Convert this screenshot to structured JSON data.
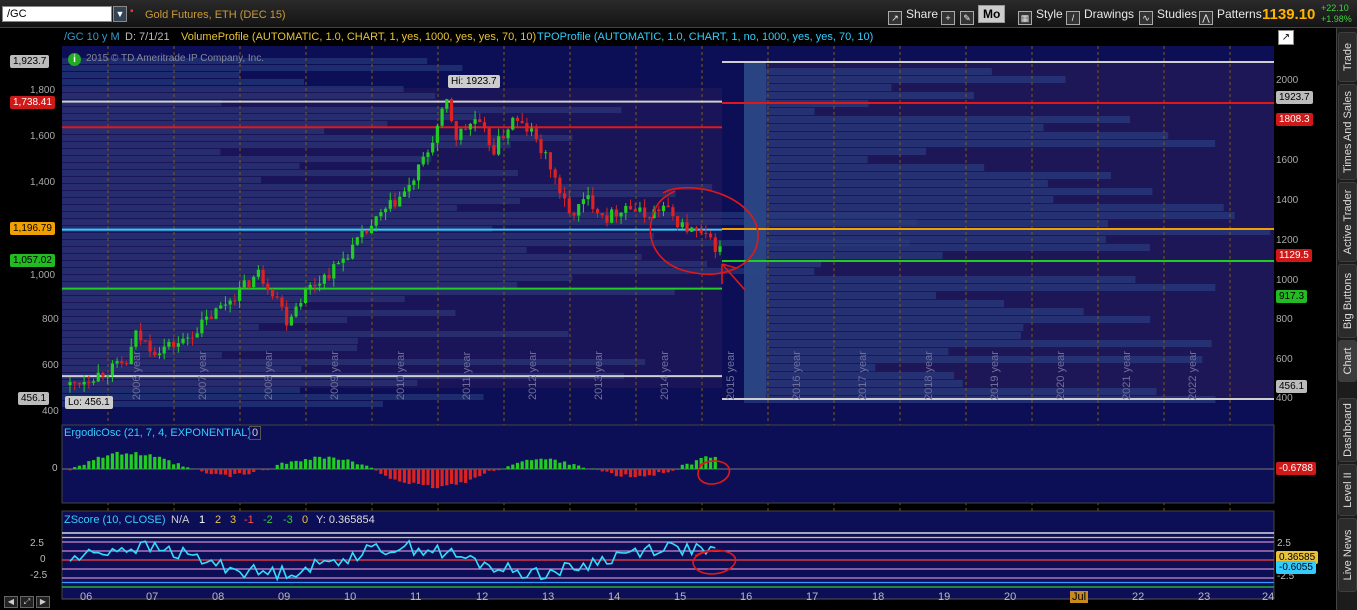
{
  "toolbar": {
    "symbol": "/GC",
    "description": "Gold Futures, ETH (DEC 15)",
    "share": "Share",
    "mo": "Mo",
    "style": "Style",
    "drawings": "Drawings",
    "studies": "Studies",
    "patterns": "Patterns",
    "last_price": "1139.10",
    "change_abs": "+22.10",
    "change_pct": "+1.98%"
  },
  "sidebar": {
    "tabs": [
      "Trade",
      "Times And Sales",
      "Active Trader",
      "Big Buttons",
      "Chart",
      "Dashboard",
      "Level II",
      "Live News"
    ]
  },
  "price_panel": {
    "period": "/GC 10 y M",
    "date": "D: 7/1/21",
    "volume_profile": "VolumeProfile (AUTOMATIC, 1.0, CHART, 1, yes, 1000, yes, yes, 70, 10)",
    "tpo_profile": "TPOProfile (AUTOMATIC, 1.0, CHART, 1, no, 1000, yes, yes, 70, 10)",
    "copyright": "2015 © TD Ameritrade IP Company, Inc.",
    "hi_label": "Hi: 1923.7",
    "lo_label": "Lo: 456.1",
    "left_labels": [
      {
        "text": "1,923.7",
        "color": "#bbbbbb",
        "fg": "#000"
      },
      {
        "text": "1,738.41",
        "color": "#d01818",
        "fg": "#fff"
      },
      {
        "text": "1,196.79",
        "color": "#f0a000",
        "fg": "#000"
      },
      {
        "text": "1,057.02",
        "color": "#22bb22",
        "fg": "#000"
      },
      {
        "text": "456.1",
        "color": "#bbbbbb",
        "fg": "#000"
      }
    ],
    "left_axis": [
      "1,800",
      "1,600",
      "1,400",
      "1,000",
      "800",
      "600",
      "400"
    ],
    "right_axis": [
      "2000",
      "1600",
      "1400",
      "1200",
      "1000",
      "800",
      "600",
      "400"
    ],
    "right_labels": [
      {
        "text": "1923.7",
        "color": "#bbbbbb",
        "fg": "#000"
      },
      {
        "text": "1808.3",
        "color": "#d01818",
        "fg": "#fff"
      },
      {
        "text": "1129.5",
        "color": "#d01818",
        "fg": "#fff"
      },
      {
        "text": "917.3",
        "color": "#22bb22",
        "fg": "#000"
      },
      {
        "text": "456.1",
        "color": "#bbbbbb",
        "fg": "#000"
      }
    ],
    "year_labels": [
      "2006 year",
      "2007 year",
      "2008 year",
      "2009 year",
      "2010 year",
      "2011 year",
      "2012 year",
      "2013 year",
      "2014 year",
      "2015 year",
      "2016 year",
      "2017 year",
      "2018 year",
      "2019 year",
      "2020 year",
      "2021 year",
      "2022 year"
    ]
  },
  "ergodic_panel": {
    "title": "ErgodicOsc (21, 7, 4, EXPONENTIAL)",
    "value_box": "0",
    "zero_label": "0",
    "right_value": "-0.6788"
  },
  "zscore_panel": {
    "title": "ZScore (10, CLOSE)",
    "na": "N/A",
    "levels": [
      "1",
      "2",
      "3",
      "-1",
      "-2",
      "-3",
      "0"
    ],
    "y_value": "Y: 0.365854",
    "left_axis": [
      "2.5",
      "0",
      "-2.5"
    ],
    "right_axis": [
      "2.5",
      "-2.5"
    ],
    "right_value_1": "0.36585",
    "right_value_2": "-0.6055"
  },
  "x_axis": [
    "06",
    "07",
    "08",
    "09",
    "10",
    "11",
    "12",
    "13",
    "14",
    "15",
    "16",
    "17",
    "18",
    "19",
    "20",
    "Jul",
    "22",
    "23",
    "24"
  ],
  "colors": {
    "panel_bg": "#0d0f56",
    "up_candle": "#22cc22",
    "down_candle": "#dd2222",
    "annotation": "#e01818"
  }
}
